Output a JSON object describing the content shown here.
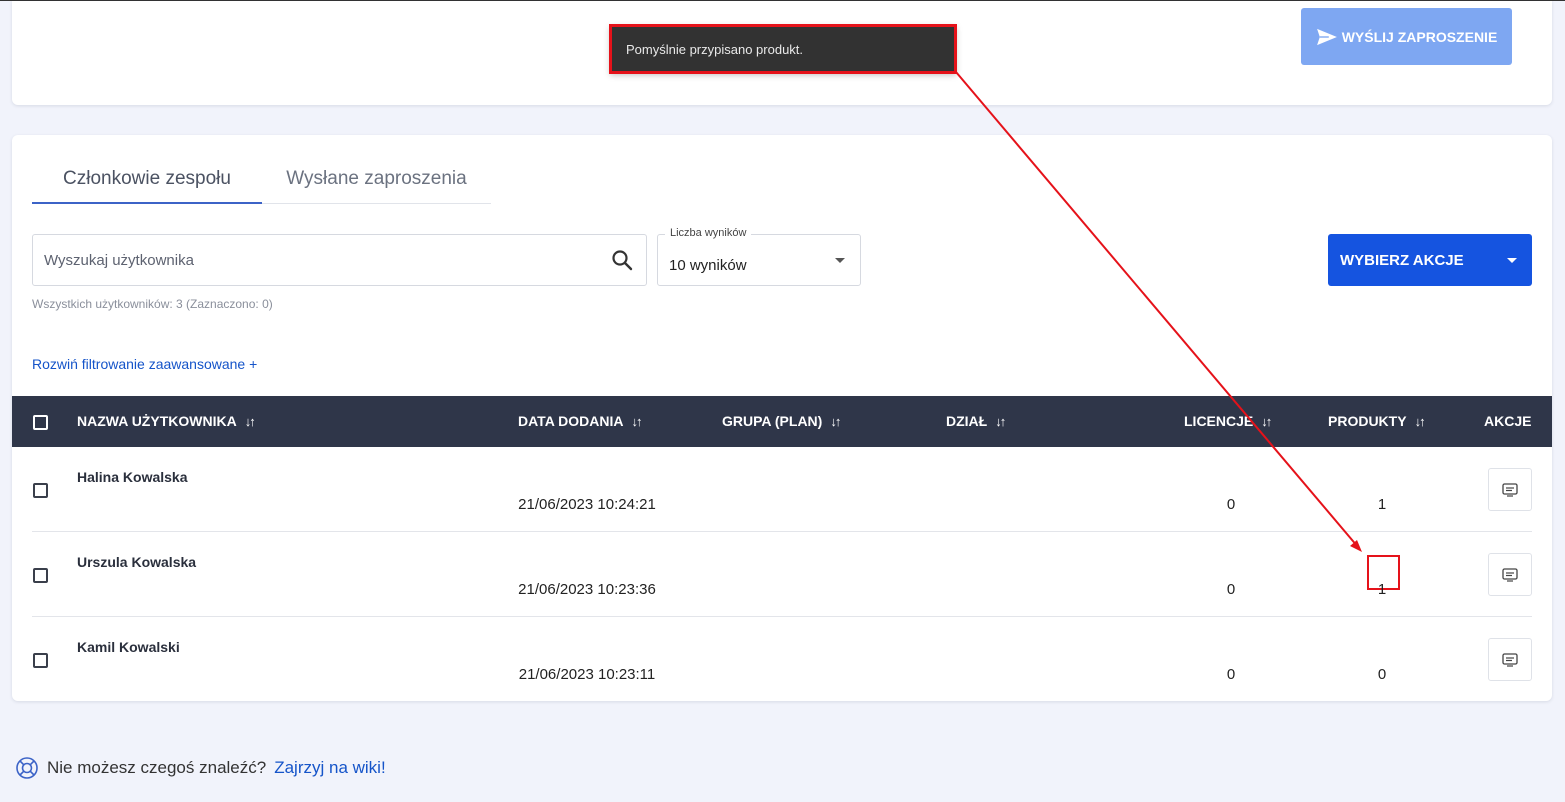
{
  "header": {
    "invite_button": "WYŚLIJ ZAPROSZENIE"
  },
  "toast": {
    "message": "Pomyślnie przypisano produkt."
  },
  "tabs": [
    {
      "label": "Członkowie zespołu",
      "active": true
    },
    {
      "label": "Wysłane zaproszenia",
      "active": false
    }
  ],
  "search": {
    "placeholder": "Wyszukaj użytkownika"
  },
  "results_select": {
    "label": "Liczba wyników",
    "value": "10 wyników"
  },
  "actions_button": "WYBIERZ AKCJE",
  "total_info": "Wszystkich użytkowników: 3 (Zaznaczono: 0)",
  "advanced_filter": "Rozwiń filtrowanie zaawansowane +",
  "table": {
    "columns": [
      "NAZWA UŻYTKOWNIKA",
      "DATA DODANIA",
      "GRUPA (PLAN)",
      "DZIAŁ",
      "LICENCJE",
      "PRODUKTY",
      "AKCJE"
    ],
    "rows": [
      {
        "name": "Halina Kowalska",
        "date": "21/06/2023 10:24:21",
        "group": "",
        "department": "",
        "licenses": "0",
        "products": "1"
      },
      {
        "name": "Urszula Kowalska",
        "date": "21/06/2023 10:23:36",
        "group": "",
        "department": "",
        "licenses": "0",
        "products": "1"
      },
      {
        "name": "Kamil Kowalski",
        "date": "21/06/2023 10:23:11",
        "group": "",
        "department": "",
        "licenses": "0",
        "products": "0"
      }
    ]
  },
  "footer": {
    "question": "Nie możesz czegoś znaleźć?",
    "link": "Zajrzyj na wiki!"
  },
  "colors": {
    "primary": "#1554e0",
    "invite_button": "#7ea7f2",
    "table_header": "#2f3649",
    "annotation": "#e5121a"
  }
}
